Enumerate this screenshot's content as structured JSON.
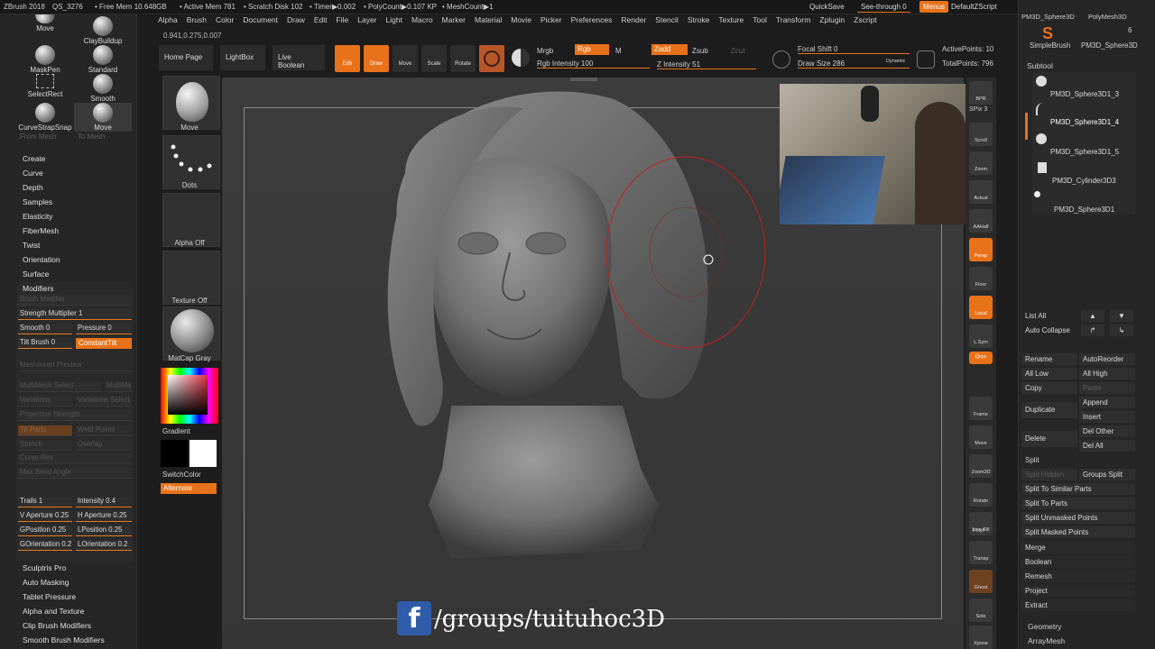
{
  "topbar": {
    "app": "ZBrush 2018",
    "doc": "QS_3276",
    "free_mem": "• Free Mem 10.648GB",
    "active_mem": "• Active Mem 781",
    "scratch": "• Scratch Disk 102",
    "timer": "• Timer▶0.002",
    "polycount": "• PolyCount▶0.107 KP",
    "meshcount": "• MeshCount▶1",
    "quicksave": "QuickSave",
    "seethrough": "See-through  0",
    "menus": "Menus",
    "script": "DefaultZScript"
  },
  "menubar": [
    "Alpha",
    "Brush",
    "Color",
    "Document",
    "Draw",
    "Edit",
    "File",
    "Layer",
    "Light",
    "Macro",
    "Marker",
    "Material",
    "Movie",
    "Picker",
    "Preferences",
    "Render",
    "Stencil",
    "Stroke",
    "Texture",
    "Tool",
    "Transform",
    "Zplugin",
    "Zscript"
  ],
  "coords": "0.941,0.275,0.007",
  "shelf": {
    "home": "Home Page",
    "lightbox": "LightBox",
    "liveboolean": "Live Boolean",
    "edit": "Edit",
    "draw": "Draw",
    "move": "Move",
    "scale": "Scale",
    "rotate": "Rotate",
    "mrgb": "Mrgb",
    "rgb": "Rgb",
    "m": "M",
    "rgb_intensity": "Rgb Intensity 100",
    "zadd": "Zadd",
    "zsub": "Zsub",
    "zcut": "Zcut",
    "z_intensity": "Z Intensity 51",
    "focal_shift": "Focal Shift 0",
    "draw_size": "Draw Size 286",
    "dynamic": "Dynamic",
    "active_points": "ActivePoints: 10",
    "total_points": "TotalPoints: 796"
  },
  "left": {
    "brushes": [
      "Move",
      "ClayBuildup",
      "MaskPen",
      "Standard",
      "SelectRect",
      "Smooth",
      "CurveStrapSnap",
      "Move"
    ],
    "from_mesh": "From Mesh",
    "to_mesh": "To Mesh",
    "stroke_menu": [
      "Create",
      "Curve",
      "Depth",
      "Samples",
      "Elasticity",
      "FiberMesh",
      "Twist",
      "Orientation",
      "Surface",
      "Modifiers"
    ],
    "brush_modifier": "Brush Modifier",
    "strength_multiplier": "Strength Multiplier 1",
    "smooth": "Smooth 0",
    "pressure": "Pressure 0",
    "tilt_brush": "Tilt Brush 0",
    "constant_tilt": "ConstantTilt",
    "meshinsert_preview": "MeshInsert Preview",
    "multimesh_select": "MultiMesh Select",
    "multimesh": "MultiMe",
    "variations": "Variations",
    "variations_select": "Variations Select",
    "projection_strength": "Projection Strength",
    "tri_parts": "Tri Parts",
    "weld_points": "Weld Points",
    "stretch": "Stretch",
    "overlap": "Overlap",
    "curve_res": "Curve Res",
    "max_bend_angle": "Max Bend Angle",
    "trails": "Trails 1",
    "intensity": "Intensity 0.4",
    "v_aperture": "V Aperture 0.25",
    "h_aperture": "H Aperture 0.25",
    "gposition": "GPosition 0.25",
    "lposition": "LPosition 0.25",
    "gorientation": "GOrientation 0.2",
    "lorientation": "LOrientation 0.2",
    "bottom_menu": [
      "Sculptris Pro",
      "Auto Masking",
      "Tablet Pressure",
      "Alpha and Texture",
      "Clip Brush Modifiers",
      "Smooth Brush Modifiers"
    ]
  },
  "col2": {
    "move": "Move",
    "dots": "Dots",
    "alpha_off": "Alpha Off",
    "texture_off": "Texture Off",
    "matcap": "MatCap Gray",
    "gradient": "Gradient",
    "switchcolor": "SwitchColor",
    "alternate": "Alternate"
  },
  "righticons": [
    "BPR",
    "SPix 3",
    "Scroll",
    "Zoom",
    "Actual",
    "AAHalf",
    "Persp",
    "Floor",
    "Local",
    "L.Sym",
    "Qxyz",
    "Frame",
    "Move",
    "Zoom3D",
    "Rotate",
    "Line Fill",
    "PolyF",
    "Transp",
    "Ghost",
    "Solo",
    "Xpose"
  ],
  "right": {
    "top_tools": [
      "PM3D_Sphere3D",
      "PolyMesh3D",
      "SimpleBrush",
      "PM3D_Sphere3D"
    ],
    "tool_count": "6",
    "subtool_title": "Subtool",
    "subtools": [
      "PM3D_Sphere3D1_3",
      "PM3D_Sphere3D1_4",
      "PM3D_Sphere3D1_5",
      "PM3D_Cylinder3D3",
      "PM3D_Sphere3D1"
    ],
    "list_all": "List All",
    "auto_collapse": "Auto Collapse",
    "rename": "Rename",
    "autoreorder": "AutoReorder",
    "all_low": "All Low",
    "all_high": "All High",
    "copy": "Copy",
    "paste": "Paste",
    "duplicate": "Duplicate",
    "append": "Append",
    "insert": "Insert",
    "delete": "Delete",
    "del_other": "Del Other",
    "del_all": "Del All",
    "split": "Split",
    "split_hidden": "Split Hidden",
    "groups_split": "Groups Split",
    "split_similar": "Split To Similar Parts",
    "split_parts": "Split To Parts",
    "split_unmasked": "Split Unmasked Points",
    "split_masked": "Split Masked Points",
    "merge": "Merge",
    "boolean": "Boolean",
    "remesh": "Remesh",
    "project": "Project",
    "extract": "Extract",
    "geometry": "Geometry",
    "arraymesh": "ArrayMesh"
  },
  "watermark": {
    "fb_letter": "f",
    "text": "/groups/tuituhoc3D"
  },
  "colors": {
    "accent": "#e8721a",
    "panel": "#262626",
    "viewport": "#3a3a3a"
  }
}
